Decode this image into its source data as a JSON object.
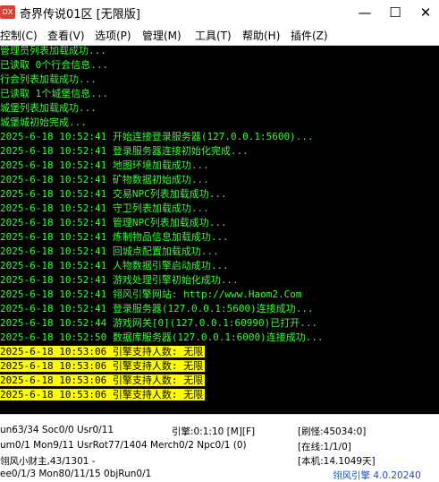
{
  "window": {
    "icon_text": "DX",
    "title": "奇界传说01区 [无限版]",
    "minimize": "—",
    "maximize": "☐",
    "close": "✕"
  },
  "menu": [
    "控制(C)",
    "查看(V)",
    "选项(P)",
    "管理(M)",
    "工具(T)",
    "帮助(H)",
    "插件(Z)"
  ],
  "console_lines": [
    {
      "text": "管理员列表加载成功...",
      "style": "g"
    },
    {
      "text": "已读取 0个行会信息...",
      "style": "g"
    },
    {
      "text": "行会列表加载成功...",
      "style": "g"
    },
    {
      "text": "已读取 1个城堡信息...",
      "style": "g"
    },
    {
      "text": "城堡列表加载成功...",
      "style": "g"
    },
    {
      "text": "城堡城初始完成...",
      "style": "g"
    },
    {
      "text": "2025-6-18 10:52:41 开始连接登录服务器(127.0.0.1:5600)...",
      "style": "g"
    },
    {
      "text": "2025-6-18 10:52:41 登录服务器连接初始化完成...",
      "style": "g"
    },
    {
      "text": "2025-6-18 10:52:41 地图环境加载成功...",
      "style": "g"
    },
    {
      "text": "2025-6-18 10:52:41 矿物数据初始成功...",
      "style": "g"
    },
    {
      "text": "2025-6-18 10:52:41 交易NPC列表加载成功...",
      "style": "g"
    },
    {
      "text": "2025-6-18 10:52:41 守卫列表加载成功...",
      "style": "g"
    },
    {
      "text": "2025-6-18 10:52:41 管理NPC列表加载成功...",
      "style": "g"
    },
    {
      "text": "2025-6-18 10:52:41 炼制物品信息加载成功...",
      "style": "g"
    },
    {
      "text": "2025-6-18 10:52:41 回城点配置加载成功...",
      "style": "g"
    },
    {
      "text": "2025-6-18 10:52:41 人物数据引擎启动成功...",
      "style": "g"
    },
    {
      "text": "2025-6-18 10:52:41 游戏处理引擎初始化成功...",
      "style": "g"
    },
    {
      "text": "2025-6-18 10:52:41 翎风引擎网站: http://www.Haom2.Com",
      "style": "g"
    },
    {
      "text": "2025-6-18 10:52:41 登录服务器(127.0.0.1:5600)连接成功...",
      "style": "g"
    },
    {
      "text": "2025-6-18 10:52:44 游戏网关[0](127.0.0.1:60990)已打开...",
      "style": "g"
    },
    {
      "text": "2025-6-18 10:52:50 数据库服务器(127.0.0.1:6000)连接成功...",
      "style": "g"
    },
    {
      "text": "2025-6-18 10:53:06 引擎支持人数: 无限",
      "style": "y"
    },
    {
      "text": "2025-6-18 10:53:06 引擎支持人数: 无限",
      "style": "y"
    },
    {
      "text": "2025-6-18 10:53:06 引擎支持人数: 无限",
      "style": "y"
    },
    {
      "text": "2025-6-18 10:53:06 引擎支持人数: 无限",
      "style": "y"
    }
  ],
  "status": {
    "row1_a": "un63/34 Soc0/0 Usr0/11",
    "row1_b": "引擎:0:1:10 [M][F]",
    "row1_c": "[刷怪:45034:0]",
    "row2_a": "um0/1 Mon9/11 UsrRot77/1404 Merch0/2 Npc0/1 (0)",
    "row2_c": "[在线:1/1/0]",
    "row3_a": "翎风小财主,43/1301 -",
    "row3_c": "[本机:14.1049天]",
    "row4_a": "ee0/1/3 Mon80/11/15 0bjRun0/1",
    "row4_c": "翎风引擎 4.0.20240"
  },
  "colors": {
    "console_bg": "#000000",
    "console_text": "#33ff33",
    "highlight_bg": "#ffff00",
    "highlight_text": "#000000"
  }
}
